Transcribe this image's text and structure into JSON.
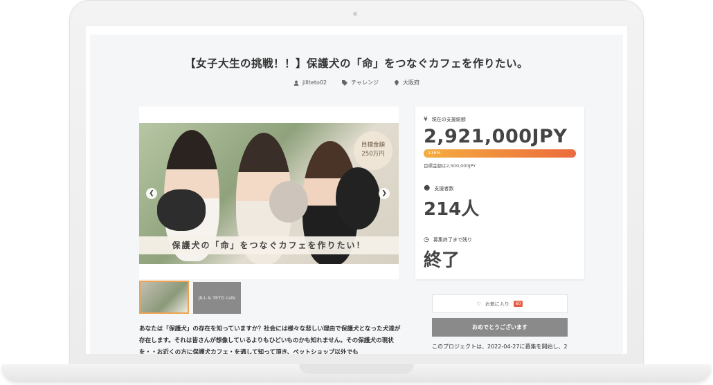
{
  "project": {
    "title": "【女子大生の挑戦！！】保護犬の「命」をつなぐカフェを作りたい。",
    "meta": {
      "user": "jillteto02",
      "category": "チャレンジ",
      "location": "大阪府"
    }
  },
  "hero_image": {
    "caption": "保護犬の「命」をつなぐカフェを作りたい！",
    "goal_badge_line1": "目標金額",
    "goal_badge_line2": "250万円",
    "prev_arrow": "❮",
    "next_arrow": "❯"
  },
  "thumbnails": [
    {
      "label": ""
    },
    {
      "label": "JILL & TETO cafe"
    }
  ],
  "description": "あなたは「保護犬」の存在を知っていますか？社会には様々な悲しい理由で保護犬となった犬達が存在します。それは皆さんが想像しているよりもひどいものかも知れません。その保護犬の現状を・・お近くの方に保護犬カフェ・を通して知って頂き、ペットショップ以外でも",
  "stats": {
    "current_label": "現在の支援総額",
    "current_amount": "2,921,000JPY",
    "progress_percent": 116,
    "progress_text": "116%",
    "goal_text": "目標金額は2,500,000JPY",
    "backers_label": "支援者数",
    "backers_value": "214人",
    "remaining_label": "募集終了まで残り",
    "remaining_value": "終了",
    "yen_icon": "yen-icon",
    "person_icon": "person-icon",
    "clock_icon": "clock-icon"
  },
  "actions": {
    "favorite_label": "お気に入り",
    "favorite_count": "60",
    "done_label": "おめでとうございます"
  },
  "project_note": "このプロジェクトは、2022-04-27に募集を開始し、2",
  "colors": {
    "accent": "#e75b43",
    "progress_start": "#f4ad3f",
    "thumb_border": "#f0a451"
  }
}
